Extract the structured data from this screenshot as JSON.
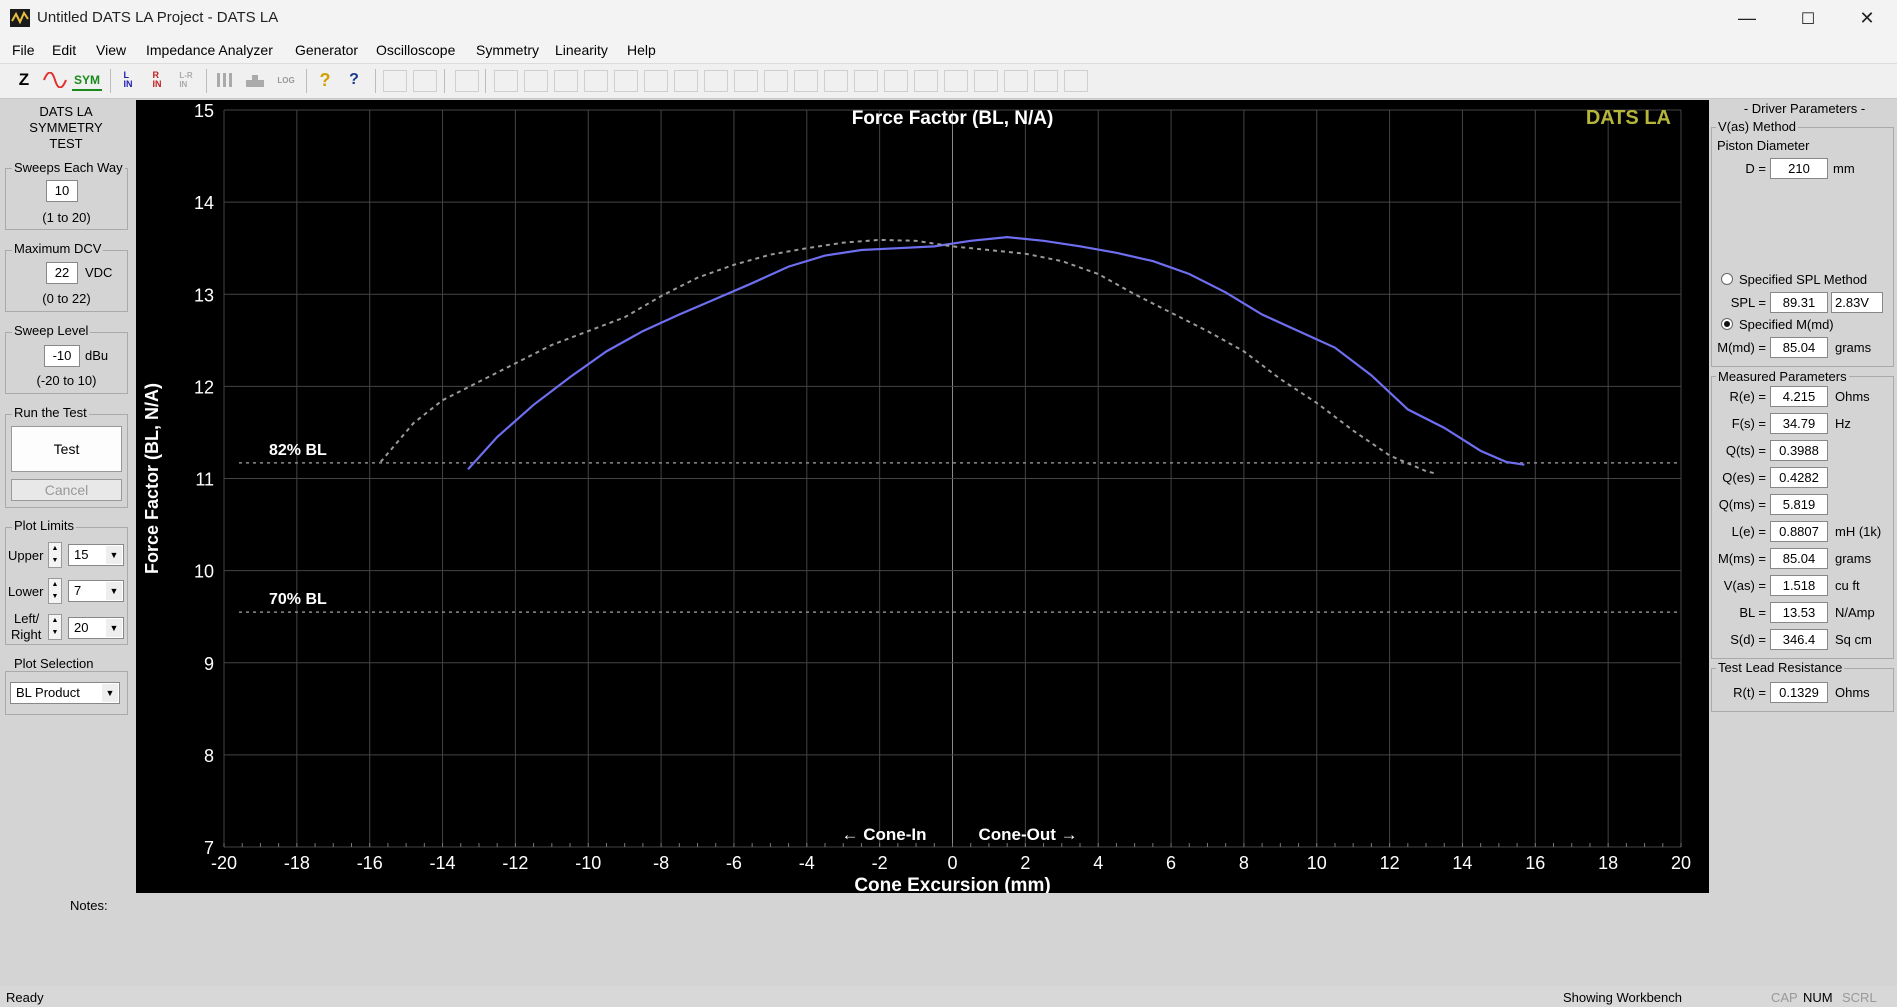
{
  "window": {
    "title": "Untitled DATS LA Project - DATS LA",
    "minimize": "—",
    "maximize": "☐",
    "close": "✕"
  },
  "menu": [
    "File",
    "Edit",
    "View",
    "Impedance Analyzer",
    "Generator",
    "Oscilloscope",
    "Symmetry",
    "Linearity",
    "Help"
  ],
  "toolbar": {
    "z": "Z",
    "sym": "SYM",
    "lin": "L\nIN",
    "rin": "R\nIN",
    "lrin": "L-R\nIN",
    "log": "LOG",
    "help": "?",
    "whatsthis": "?"
  },
  "left": {
    "heading": [
      "DATS LA",
      "SYMMETRY",
      "TEST"
    ],
    "sweeps": {
      "title": "Sweeps Each Way",
      "value": "10",
      "range": "(1 to 20)"
    },
    "maxdcv": {
      "title": "Maximum DCV",
      "value": "22",
      "unit": "VDC",
      "range": "(0 to 22)"
    },
    "sweeplevel": {
      "title": "Sweep Level",
      "value": "-10",
      "unit": "dBu",
      "range": "(-20 to 10)"
    },
    "run": {
      "title": "Run the Test",
      "test": "Test",
      "cancel": "Cancel"
    },
    "plotlimits": {
      "title": "Plot Limits",
      "upper_label": "Upper",
      "upper": "15",
      "lower_label": "Lower",
      "lower": "7",
      "lr_label1": "Left/",
      "lr_label2": "Right",
      "lr": "20"
    },
    "plotsel": {
      "title": "Plot Selection",
      "value": "BL Product"
    }
  },
  "notes_label": "Notes:",
  "chart_data": {
    "type": "line",
    "title": "Force Factor (BL, N/A)",
    "watermark": "DATS LA",
    "xlabel": "Cone Excursion (mm)",
    "ylabel": "Force Factor (BL, N/A)",
    "xlim": [
      -20,
      20
    ],
    "ylim": [
      7,
      15
    ],
    "xticks": [
      -20,
      -18,
      -16,
      -14,
      -12,
      -10,
      -8,
      -6,
      -4,
      -2,
      0,
      2,
      4,
      6,
      8,
      10,
      12,
      14,
      16,
      18,
      20
    ],
    "yticks": [
      7,
      8,
      9,
      10,
      11,
      12,
      13,
      14,
      15
    ],
    "grid": true,
    "reference_lines": [
      {
        "label": "82% BL",
        "y": 11.17
      },
      {
        "label": "70% BL",
        "y": 9.55
      }
    ],
    "annotations": {
      "cone_in": "← Cone-In",
      "cone_out": "Cone-Out →"
    },
    "series": [
      {
        "style": "solid",
        "color": "#6e6ef0",
        "x": [
          -13.3,
          -12.5,
          -11.5,
          -10.5,
          -9.5,
          -8.5,
          -7.5,
          -6.5,
          -5.5,
          -4.5,
          -3.5,
          -2.5,
          -1.5,
          -0.5,
          0.5,
          1.5,
          2.5,
          3.5,
          4.5,
          5.5,
          6.5,
          7.5,
          8.5,
          9.5,
          10.5,
          11.5,
          12.5,
          13.5,
          14.5,
          15.2,
          15.7
        ],
        "y": [
          11.1,
          11.45,
          11.8,
          12.1,
          12.38,
          12.6,
          12.78,
          12.95,
          13.12,
          13.3,
          13.42,
          13.48,
          13.5,
          13.52,
          13.58,
          13.62,
          13.58,
          13.52,
          13.45,
          13.36,
          13.22,
          13.02,
          12.78,
          12.6,
          12.42,
          12.12,
          11.75,
          11.55,
          11.3,
          11.18,
          11.15
        ]
      },
      {
        "style": "dashed",
        "color": "#9a9a9a",
        "x": [
          -15.7,
          -14.8,
          -14,
          -13,
          -12,
          -11,
          -10,
          -9,
          -8,
          -7,
          -6,
          -5,
          -4,
          -3,
          -2,
          -1,
          0,
          1,
          2,
          3,
          4,
          5,
          6,
          7,
          8,
          9,
          10,
          11,
          12,
          13,
          13.3
        ],
        "y": [
          11.18,
          11.6,
          11.85,
          12.05,
          12.25,
          12.45,
          12.6,
          12.75,
          12.98,
          13.18,
          13.32,
          13.43,
          13.5,
          13.56,
          13.59,
          13.58,
          13.52,
          13.48,
          13.44,
          13.36,
          13.22,
          13.0,
          12.8,
          12.6,
          12.38,
          12.08,
          11.82,
          11.52,
          11.25,
          11.08,
          11.05
        ]
      }
    ]
  },
  "right": {
    "heading": "- Driver Parameters -",
    "vas_method": "V(as) Method",
    "piston_diameter": "Piston Diameter",
    "d": {
      "label": "D =",
      "value": "210",
      "unit": "mm"
    },
    "spl_method": "Specified SPL Method",
    "spl": {
      "label": "SPL =",
      "value": "89.31",
      "unit": "2.83V"
    },
    "mmd_method": "Specified M(md)",
    "mmd": {
      "label": "M(md) =",
      "value": "85.04",
      "unit": "grams"
    },
    "measured_title": "Measured Parameters",
    "measured": [
      {
        "label": "R(e) =",
        "value": "4.215",
        "unit": "Ohms"
      },
      {
        "label": "F(s) =",
        "value": "34.79",
        "unit": "Hz"
      },
      {
        "label": "Q(ts) =",
        "value": "0.3988",
        "unit": ""
      },
      {
        "label": "Q(es) =",
        "value": "0.4282",
        "unit": ""
      },
      {
        "label": "Q(ms) =",
        "value": "5.819",
        "unit": ""
      },
      {
        "label": "L(e) =",
        "value": "0.8807",
        "unit": "mH (1k)"
      },
      {
        "label": "M(ms) =",
        "value": "85.04",
        "unit": "grams"
      },
      {
        "label": "V(as) =",
        "value": "1.518",
        "unit": "cu ft"
      },
      {
        "label": "BL =",
        "value": "13.53",
        "unit": "N/Amp"
      },
      {
        "label": "S(d) =",
        "value": "346.4",
        "unit": "Sq cm"
      }
    ],
    "lead_title": "Test Lead Resistance",
    "rt": {
      "label": "R(t) =",
      "value": "0.1329",
      "unit": "Ohms"
    }
  },
  "status": {
    "ready": "Ready",
    "workbench": "Showing Workbench",
    "cap": "CAP",
    "num": "NUM",
    "scrl": "SCRL"
  }
}
